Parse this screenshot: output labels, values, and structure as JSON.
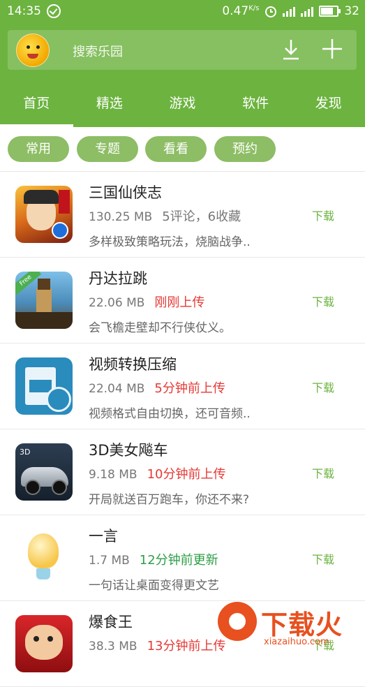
{
  "status_bar": {
    "time": "14:35",
    "speed": "0.47",
    "speed_unit": "K/s",
    "battery": "32"
  },
  "search": {
    "placeholder": "搜索乐园"
  },
  "tabs": [
    {
      "label": "首页",
      "active": true
    },
    {
      "label": "精选",
      "active": false
    },
    {
      "label": "游戏",
      "active": false
    },
    {
      "label": "软件",
      "active": false
    },
    {
      "label": "发现",
      "active": false
    }
  ],
  "chips": [
    "常用",
    "专题",
    "看看",
    "预约"
  ],
  "apps": [
    {
      "name": "三国仙侠志",
      "size": "130.25 MB",
      "status": "5评论，6收藏",
      "status_color": "#777777",
      "desc": "多样极致策略玩法，烧脑战争..",
      "download": "下载"
    },
    {
      "name": "丹达拉跳",
      "size": "22.06 MB",
      "status": "刚刚上传",
      "status_color": "#e53935",
      "desc": "会飞檐走壁却不行侠仗义。",
      "download": "下载"
    },
    {
      "name": "视频转换压缩",
      "size": "22.04 MB",
      "status": "5分钟前上传",
      "status_color": "#e53935",
      "desc": "视频格式自由切换，还可音频..",
      "download": "下载"
    },
    {
      "name": "3D美女飚车",
      "size": "9.18 MB",
      "status": "10分钟前上传",
      "status_color": "#e53935",
      "desc": "开局就送百万跑车，你还不来?",
      "download": "下载"
    },
    {
      "name": "一言",
      "size": "1.7 MB",
      "status": "12分钟前更新",
      "status_color": "#2e9e47",
      "desc": "一句话让桌面变得更文艺",
      "download": "下载"
    },
    {
      "name": "爆食王",
      "size": "38.3 MB",
      "status": "13分钟前上传",
      "status_color": "#e53935",
      "desc": "",
      "download": "下载"
    }
  ],
  "watermark": {
    "brand": "下载火",
    "url": "xiazaihuo.com"
  },
  "colors": {
    "accent": "#6cb33f",
    "chip": "#8dbd64"
  }
}
